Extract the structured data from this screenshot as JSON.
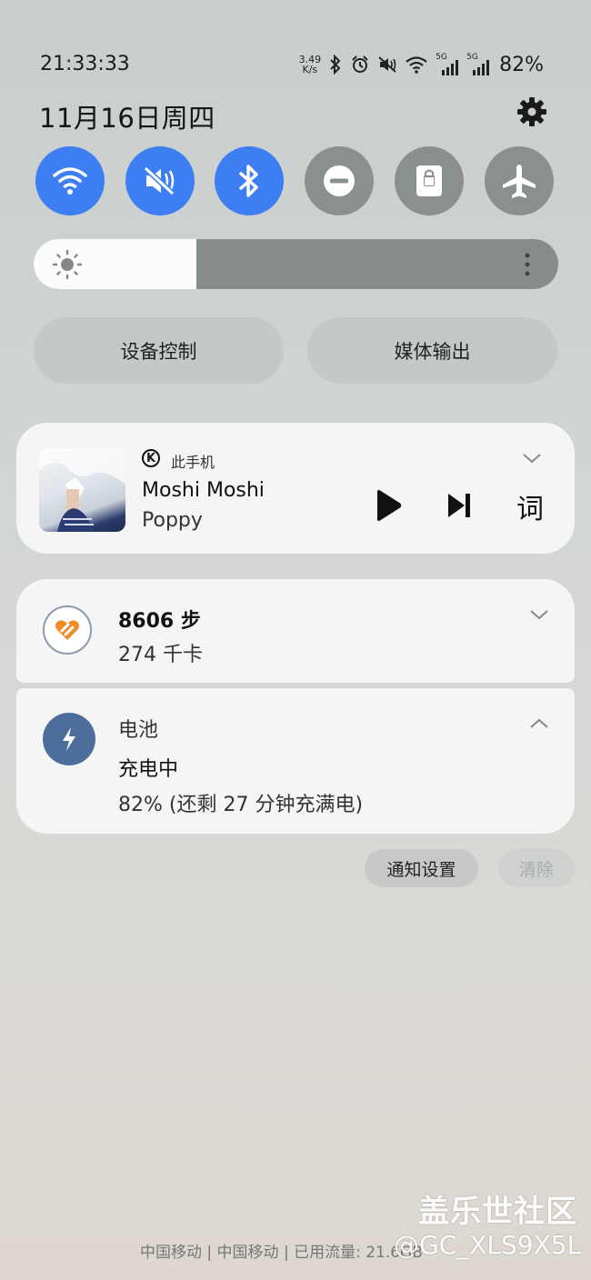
{
  "status_bar": {
    "time": "21:33:33",
    "net_speed_value": "3.49",
    "net_speed_unit": "K/s",
    "sim1": "5G",
    "sim2": "5G",
    "battery": "82%"
  },
  "header": {
    "date": "11月16日周四"
  },
  "toggles": [
    {
      "name": "wifi",
      "state": "on"
    },
    {
      "name": "mute",
      "state": "on"
    },
    {
      "name": "bluetooth",
      "state": "on"
    },
    {
      "name": "do-not-disturb",
      "state": "off"
    },
    {
      "name": "rotation-lock",
      "state": "off"
    },
    {
      "name": "airplane",
      "state": "off"
    }
  ],
  "brightness": {
    "level": 0.31
  },
  "pills": {
    "device_control": "设备控制",
    "media_output": "媒体输出"
  },
  "media": {
    "source_icon": "K",
    "source": "此手机",
    "title": "Moshi Moshi",
    "artist": "Poppy",
    "lyrics_label": "词"
  },
  "health": {
    "steps": "8606 步",
    "kcal": "274 千卡"
  },
  "battery_notification": {
    "title": "电池",
    "status": "充电中",
    "detail": "82% (还剩 27 分钟充满电)"
  },
  "actions": {
    "notification_settings": "通知设置",
    "clear": "清除"
  },
  "footer": {
    "carrier": "中国移动 | 中国移动 | 已用流量: 21.6GB",
    "watermark_title": "盖乐世社区",
    "watermark_user": "@GC_XLS9X5L"
  },
  "colors": {
    "toggle_on": "#3d7ef3",
    "toggle_off": "#8a8f8f",
    "card_bg": "#f5f5f5",
    "battery_icon_bg": "#4d6e9c",
    "health_accent": "#f08a24"
  }
}
